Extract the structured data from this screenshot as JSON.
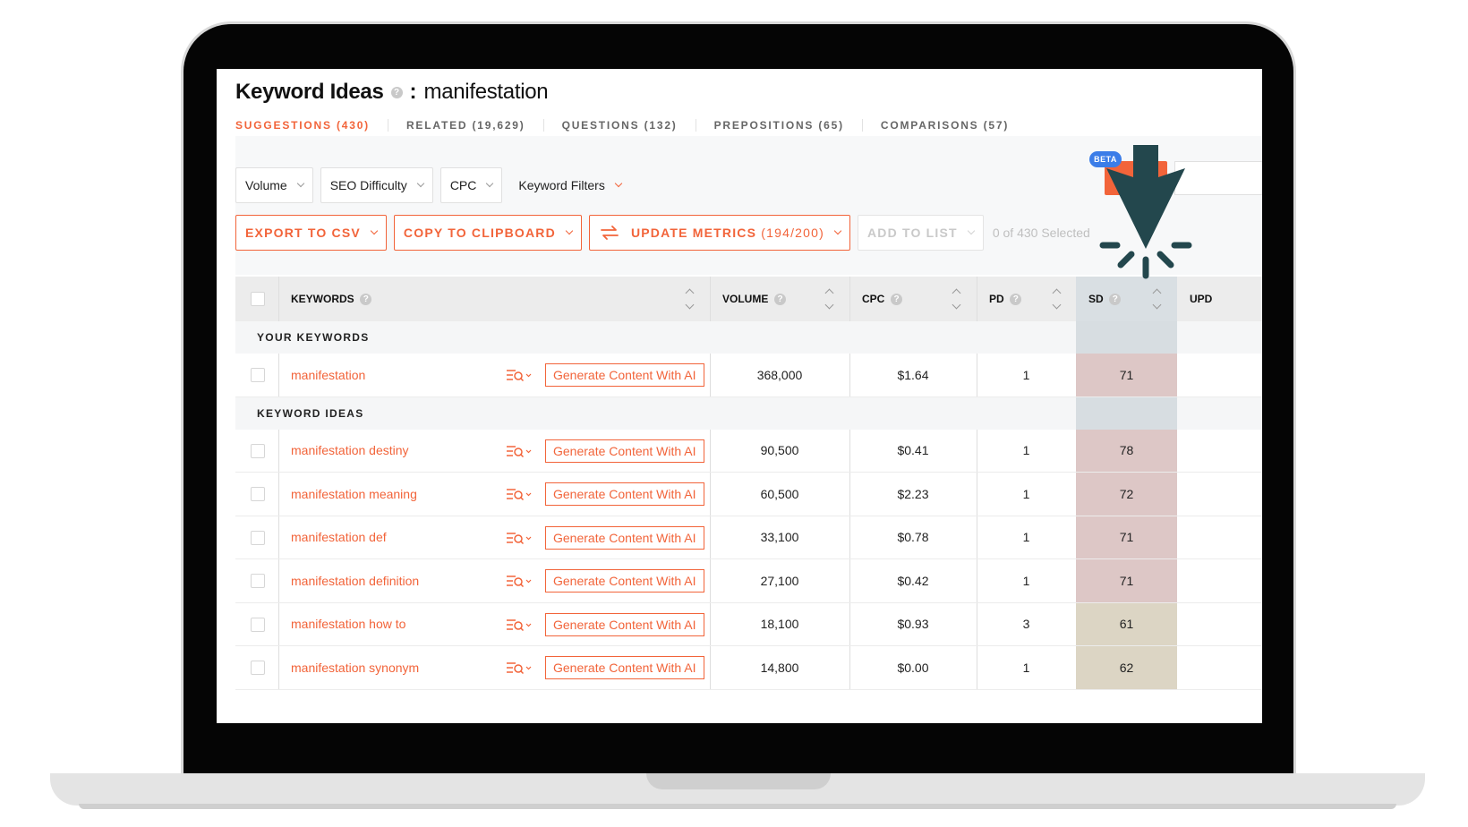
{
  "page": {
    "title": "Keyword Ideas",
    "separator": ":",
    "term": "manifestation",
    "help_glyph": "?"
  },
  "tabs": [
    {
      "label": "SUGGESTIONS (430)",
      "active": true
    },
    {
      "label": "RELATED (19,629)",
      "active": false
    },
    {
      "label": "QUESTIONS (132)",
      "active": false
    },
    {
      "label": "PREPOSITIONS (65)",
      "active": false
    },
    {
      "label": "COMPARISONS (57)",
      "active": false
    }
  ],
  "filters": [
    "Volume",
    "SEO Difficulty",
    "CPC",
    "Keyword Filters"
  ],
  "beta_badge": "BETA",
  "actions": {
    "export": "EXPORT TO CSV",
    "copy": "COPY TO CLIPBOARD",
    "update": "UPDATE METRICS",
    "update_count": "(194/200)",
    "add": "ADD TO LIST",
    "selected": "0 of 430 Selected"
  },
  "columns": {
    "keywords": "KEYWORDS",
    "volume": "VOLUME",
    "cpc": "CPC",
    "pd": "PD",
    "sd": "SD",
    "upd": "UPD"
  },
  "sections": {
    "yours": "YOUR KEYWORDS",
    "ideas": "KEYWORD IDEAS"
  },
  "generate_label": "Generate Content With AI",
  "your_keywords": [
    {
      "keyword": "manifestation",
      "volume": "368,000",
      "cpc": "$1.64",
      "pd": "1",
      "sd": "71",
      "sd_level": "high"
    }
  ],
  "keyword_ideas": [
    {
      "keyword": "manifestation destiny",
      "volume": "90,500",
      "cpc": "$0.41",
      "pd": "1",
      "sd": "78",
      "sd_level": "high"
    },
    {
      "keyword": "manifestation meaning",
      "volume": "60,500",
      "cpc": "$2.23",
      "pd": "1",
      "sd": "72",
      "sd_level": "high"
    },
    {
      "keyword": "manifestation def",
      "volume": "33,100",
      "cpc": "$0.78",
      "pd": "1",
      "sd": "71",
      "sd_level": "high"
    },
    {
      "keyword": "manifestation definition",
      "volume": "27,100",
      "cpc": "$0.42",
      "pd": "1",
      "sd": "71",
      "sd_level": "high"
    },
    {
      "keyword": "manifestation how to",
      "volume": "18,100",
      "cpc": "$0.93",
      "pd": "3",
      "sd": "61",
      "sd_level": "medium"
    },
    {
      "keyword": "manifestation synonym",
      "volume": "14,800",
      "cpc": "$0.00",
      "pd": "1",
      "sd": "62",
      "sd_level": "medium"
    }
  ],
  "colors": {
    "accent": "#f2643a",
    "arrow": "#23474d",
    "beta": "#3b7de8",
    "sd_high": "#ddc7c6",
    "sd_medium": "#dcd5c4"
  }
}
